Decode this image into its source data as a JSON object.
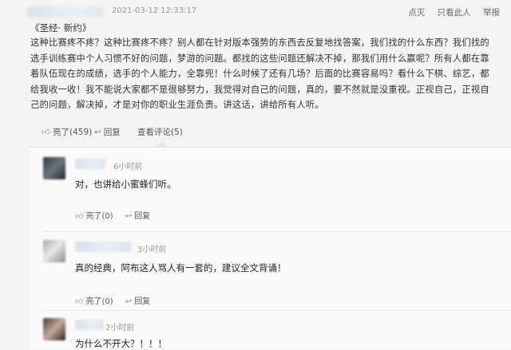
{
  "header": {
    "time": "2021-03-12 12:33:17",
    "actions": [
      "点灭",
      "只看此人",
      "举报"
    ]
  },
  "post": {
    "title": "《圣经· 新约》",
    "content": "这种比赛疼不疼？这种比赛疼不疼？别人都在针对版本强势的东西去反复地找答案，我们找的什么东西？我们找的选手训练赛中个人习惯不好的问题，梦游的问题。都找的这些问题还解决不掉，那我们用什么赢呢？所有人都在靠着队伍现在的成绩，选手的个人能力，全靠兜！什么时候了还有几场？后面的比赛容易吗？看什么下棋、综艺，都给我收一收！我不能说大家都不是很够努力，我觉得对自己的问题，真的，要不然就是没重视。正视自己，正视自己的问题，解决掉，才是对你的职业生涯负责。讲这话，讲给所有人听。"
  },
  "bar": {
    "like": "亮了(459)",
    "reply": "回复",
    "view_comments": "查看评论(5)"
  },
  "comments": [
    {
      "time": "6小时前",
      "text": "对，也讲给小蜜蜂们听。",
      "like": "亮了(0)",
      "reply": "回复"
    },
    {
      "time": "3小时前",
      "text": "真的经典，阿布这人骂人有一套的，建议全文背诵！",
      "like": "亮了(0)",
      "reply": "回复"
    },
    {
      "time": "2小时前",
      "text": "为什么不开大？！！！"
    }
  ],
  "icons": {
    "like": "thumbs-up-icon",
    "reply": "reply-arrow-icon"
  },
  "colors": {
    "link": "#3d6fa6",
    "panel": "#fafafa",
    "page": "#f4f4f4"
  }
}
